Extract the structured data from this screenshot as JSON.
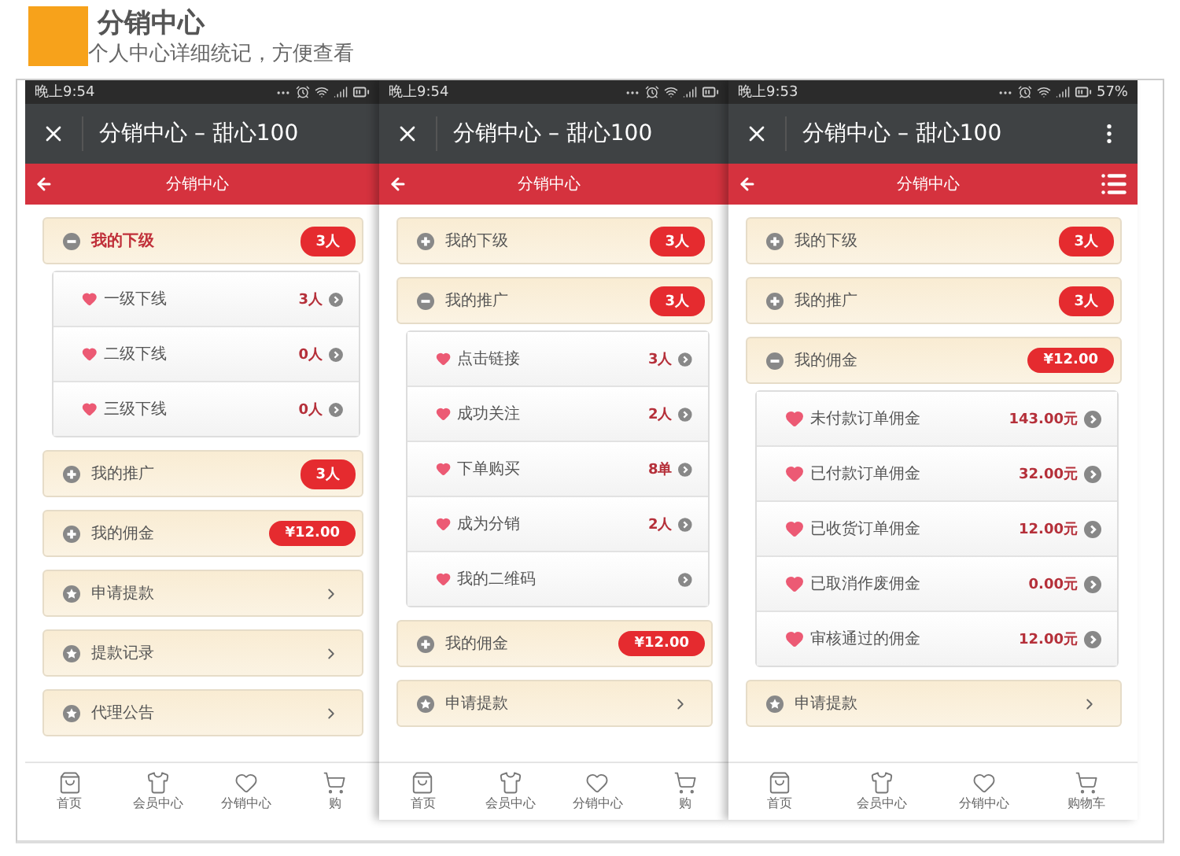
{
  "header": {
    "title": "分销中心",
    "subtitle": "个人中心详细统记，方便查看"
  },
  "phones": [
    {
      "time": "晚上9:54",
      "title": "分销中心 – 甜心100",
      "menu": false,
      "page_title": "分销中心",
      "list_icon": false,
      "sections": [
        {
          "kind": "group",
          "label": "我的下级",
          "expanded": true,
          "active": true,
          "badge": "3人",
          "children": [
            {
              "label": "一级下线",
              "value": "3人"
            },
            {
              "label": "二级下线",
              "value": "0人"
            },
            {
              "label": "三级下线",
              "value": "0人"
            }
          ]
        },
        {
          "kind": "group",
          "label": "我的推广",
          "expanded": false,
          "active": false,
          "badge": "3人"
        },
        {
          "kind": "group",
          "label": "我的佣金",
          "expanded": false,
          "active": false,
          "badge": "¥12.00"
        },
        {
          "kind": "link",
          "label": "申请提款"
        },
        {
          "kind": "link",
          "label": "提款记录"
        },
        {
          "kind": "link",
          "label": "代理公告"
        }
      ],
      "tabs": [
        "首页",
        "会员中心",
        "分销中心",
        "购"
      ]
    },
    {
      "time": "晚上9:54",
      "title": "分销中心 – 甜心100",
      "menu": false,
      "page_title": "分销中心",
      "list_icon": false,
      "sections": [
        {
          "kind": "group",
          "label": "我的下级",
          "expanded": false,
          "active": false,
          "badge": "3人"
        },
        {
          "kind": "group",
          "label": "我的推广",
          "expanded": true,
          "active": false,
          "badge": "3人",
          "children": [
            {
              "label": "点击链接",
              "value": "3人"
            },
            {
              "label": "成功关注",
              "value": "2人"
            },
            {
              "label": "下单购买",
              "value": "8单"
            },
            {
              "label": "成为分销",
              "value": "2人"
            },
            {
              "label": "我的二维码"
            }
          ]
        },
        {
          "kind": "group",
          "label": "我的佣金",
          "expanded": false,
          "active": false,
          "badge": "¥12.00"
        },
        {
          "kind": "link",
          "label": "申请提款"
        }
      ],
      "tabs": [
        "首页",
        "会员中心",
        "分销中心",
        "购"
      ]
    },
    {
      "time": "晚上9:53",
      "battery": "57%",
      "title": "分销中心 – 甜心100",
      "menu": true,
      "page_title": "分销中心",
      "list_icon": true,
      "sections": [
        {
          "kind": "group",
          "label": "我的下级",
          "expanded": false,
          "active": false,
          "badge": "3人"
        },
        {
          "kind": "group",
          "label": "我的推广",
          "expanded": false,
          "active": false,
          "badge": "3人"
        },
        {
          "kind": "group",
          "label": "我的佣金",
          "expanded": true,
          "active": false,
          "badge": "¥12.00",
          "children": [
            {
              "label": "未付款订单佣金",
              "value": "143.00元"
            },
            {
              "label": "已付款订单佣金",
              "value": "32.00元"
            },
            {
              "label": "已收货订单佣金",
              "value": "12.00元"
            },
            {
              "label": "已取消作废佣金",
              "value": "0.00元"
            },
            {
              "label": "审核通过的佣金",
              "value": "12.00元"
            }
          ]
        },
        {
          "kind": "link",
          "label": "申请提款"
        }
      ],
      "tabs": [
        "首页",
        "会员中心",
        "分销中心",
        "购物车"
      ]
    }
  ]
}
